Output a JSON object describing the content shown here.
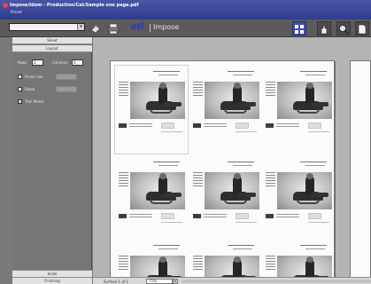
{
  "window": {
    "title": "Impose/Idom - Production/Cat/Sample one page.pdf",
    "preset_label": "Preset"
  },
  "toolbar": {
    "preset_value": "",
    "brand": "efi",
    "product": "Impose",
    "buttons": [
      "layout-view-icon",
      "print-icon",
      "zoom-icon",
      "document-icon"
    ]
  },
  "left_panel": {
    "sheet_tab": "Sheet",
    "layout_tab": "Layout",
    "rows_label": "Rows",
    "rows_value": "2",
    "columns_label": "Columns",
    "columns_value": "3",
    "finish_size_label": "Finish size",
    "bleed_label": "Bleed",
    "trim_marks_label": "Trim Marks",
    "trim_marks_checked": true,
    "scale_tab": "Scale",
    "finishing_tab": "Finishing"
  },
  "statusbar": {
    "sheet_count": "Surface 1 of 1",
    "zoom": "75%"
  },
  "colors": {
    "titlebar": "#2f3c8c",
    "brand": "#2b3cb8",
    "active_tool": "#3e4fa8"
  }
}
